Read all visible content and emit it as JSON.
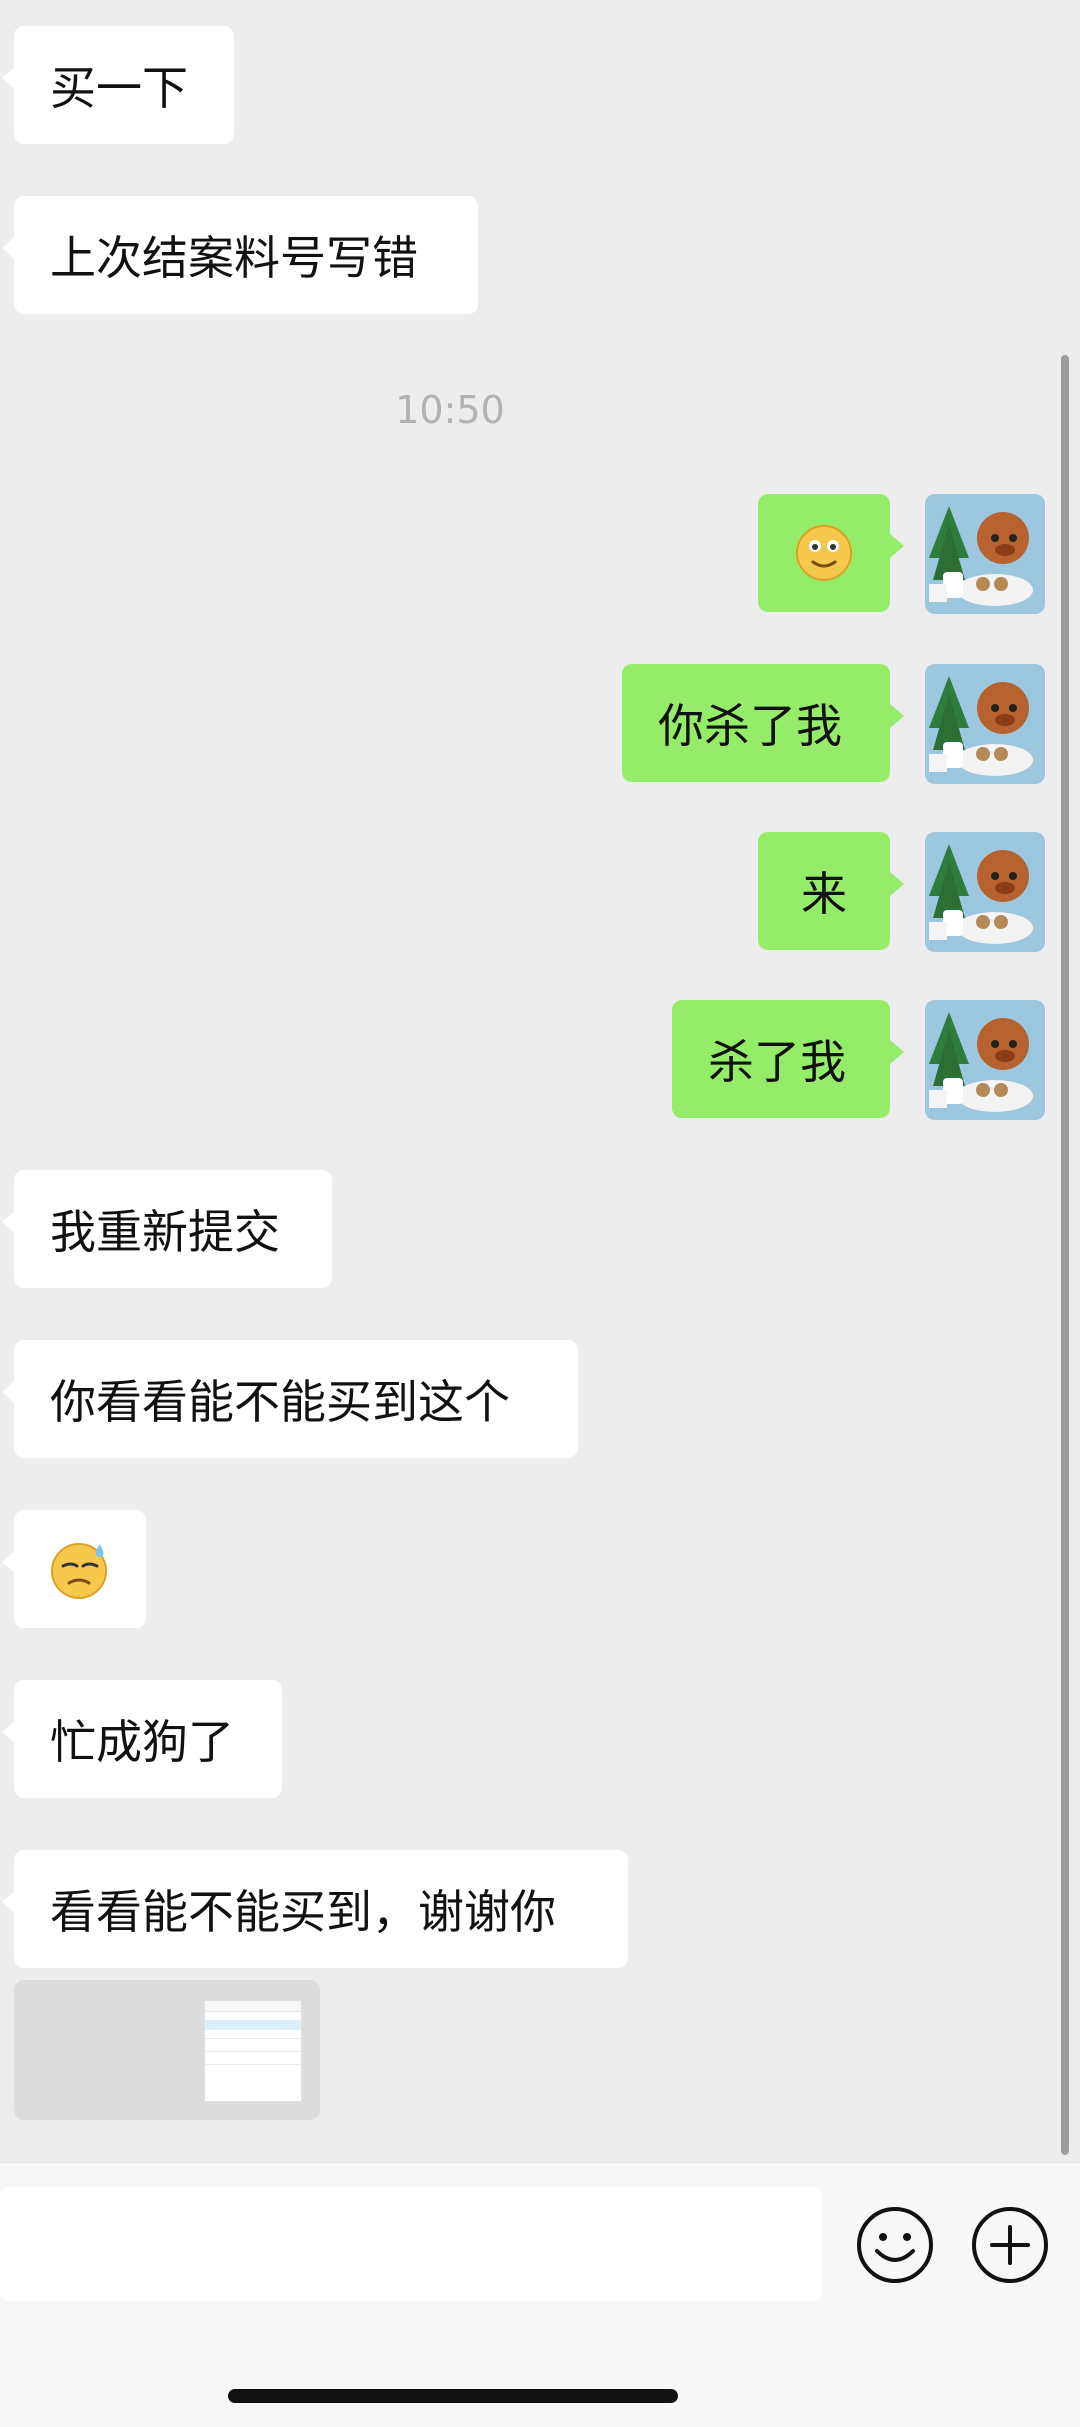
{
  "messages": {
    "m1": "买一下",
    "m2": "上次结案料号写错",
    "time": "10:50",
    "s1_icon": "slightly-smiling-face-emoji",
    "s2": "你杀了我",
    "s3": "来",
    "s4": "杀了我",
    "m5": "我重新提交",
    "m6": "你看看能不能买到这个",
    "m7_icon": "sweat-smile-face-emoji",
    "m8": "忙成狗了",
    "m9": "看看能不能买到，谢谢你",
    "attachment_icon": "file-card-icon"
  },
  "colors": {
    "incoming_bubble": "#ffffff",
    "outgoing_bubble": "#95ec69",
    "background": "#ededed"
  },
  "input": {
    "placeholder": "",
    "emoji_button_icon": "smile-icon",
    "add_button_icon": "plus-circle-icon"
  }
}
